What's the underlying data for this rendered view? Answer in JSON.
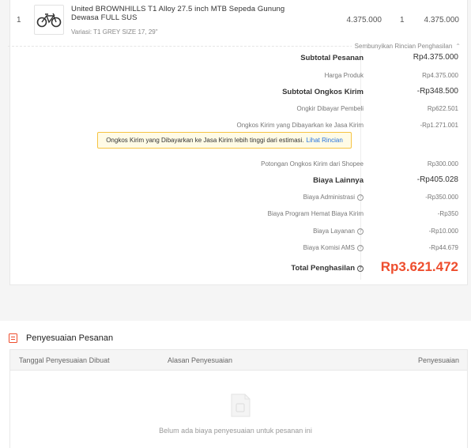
{
  "order_item": {
    "no": "1",
    "image_icon": "bicycle-icon",
    "name": "United BROWNHILLS T1 Alloy 27.5 inch MTB Sepeda Gunung Dewasa FULL SUS",
    "variant": "Variasi: T1 GREY SIZE 17, 29\"",
    "unit_price": "4.375.000",
    "qty": "1",
    "subtotal": "4.375.000"
  },
  "toggle": {
    "label": "Sembunyikan Rincian Penghasilan",
    "icon": "chevron-up-icon"
  },
  "breakdown": [
    {
      "label": "Subtotal Pesanan",
      "value": "Rp4.375.000",
      "bold": true,
      "info": false
    },
    {
      "label": "Harga Produk",
      "value": "Rp4.375.000",
      "bold": false,
      "info": false
    },
    {
      "label": "Subtotal Ongkos Kirim",
      "value": "-Rp348.500",
      "bold": true,
      "info": false
    },
    {
      "label": "Ongkir Dibayar Pembeli",
      "value": "Rp622.501",
      "bold": false,
      "info": false
    },
    {
      "label": "Ongkos Kirim yang Dibayarkan ke Jasa Kirim",
      "value": "-Rp1.271.001",
      "bold": false,
      "info": false
    },
    {
      "label": "Potongan Ongkos Kirim dari Shopee",
      "value": "Rp300.000",
      "bold": false,
      "info": false
    },
    {
      "label": "Biaya Lainnya",
      "value": "-Rp405.028",
      "bold": true,
      "info": false
    },
    {
      "label": "Biaya Administrasi",
      "value": "-Rp350.000",
      "bold": false,
      "info": true
    },
    {
      "label": "Biaya Program Hemat Biaya Kirim",
      "value": "-Rp350",
      "bold": false,
      "info": false
    },
    {
      "label": "Biaya Layanan",
      "value": "-Rp10.000",
      "bold": false,
      "info": true
    },
    {
      "label": "Biaya Komisi AMS",
      "value": "-Rp44.679",
      "bold": false,
      "info": true
    }
  ],
  "warning": {
    "text": "Ongkos Kirim yang Dibayarkan ke Jasa Kirim lebih tinggi dari estimasi.",
    "link": "Lihat Rincian"
  },
  "total": {
    "label": "Total Penghasilan",
    "value": "Rp3.621.472"
  },
  "adjustment": {
    "title": "Penyesuaian Pesanan",
    "columns": [
      "Tanggal Penyesuaian Dibuat",
      "Alasan Penyesuaian",
      "Penyesuaian"
    ],
    "empty_text": "Belum ada biaya penyesuaian untuk pesanan ini"
  },
  "colors": {
    "accent": "#ee4d2d",
    "link": "#2673dd",
    "warning_bg": "#fffbe6",
    "warning_border": "#f6c342"
  }
}
